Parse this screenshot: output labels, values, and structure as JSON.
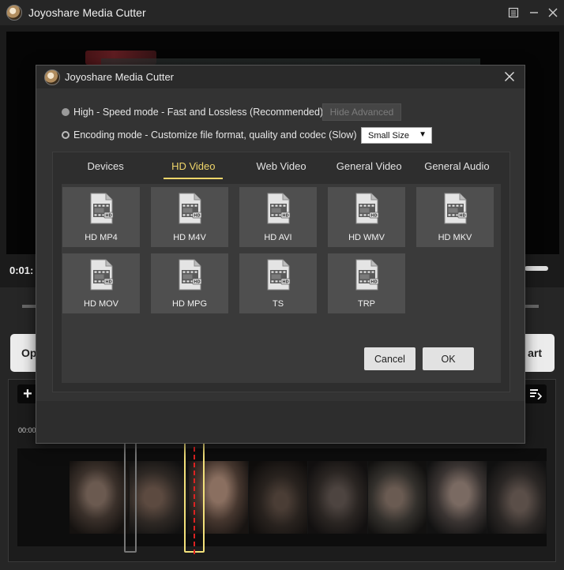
{
  "main_window": {
    "title": "Joyoshare Media Cutter",
    "time_display": "0:01:",
    "open_button_label": "Op",
    "start_button_label": "art",
    "timeline_start_time": "00:00",
    "add_button_label": "+",
    "win_controls": {
      "menu_icon": "menu-icon",
      "minimize_icon": "minimize-icon",
      "close_icon": "close-icon"
    }
  },
  "dialog": {
    "title": "Joyoshare Media Cutter",
    "close_icon": "close-icon",
    "modes": [
      {
        "label": "High - Speed mode - Fast and Lossless (Recommended)",
        "selected": false
      },
      {
        "label": "Encoding mode - Customize file format, quality and codec (Slow)",
        "selected": true
      }
    ],
    "hide_advanced_label": "Hide Advanced",
    "quality_select": {
      "value": "Small Size"
    },
    "tabs": [
      {
        "label": "Devices",
        "active": false
      },
      {
        "label": "HD Video",
        "active": true
      },
      {
        "label": "Web Video",
        "active": false
      },
      {
        "label": "General Video",
        "active": false
      },
      {
        "label": "General Audio",
        "active": false
      }
    ],
    "formats": [
      {
        "label": "HD MP4"
      },
      {
        "label": "HD M4V"
      },
      {
        "label": "HD AVI"
      },
      {
        "label": "HD WMV"
      },
      {
        "label": "HD MKV"
      },
      {
        "label": "HD MOV"
      },
      {
        "label": "HD MPG"
      },
      {
        "label": "TS"
      },
      {
        "label": "TRP"
      }
    ],
    "cancel_label": "Cancel",
    "ok_label": "OK"
  },
  "colors": {
    "accent_tab": "#f0d66a",
    "dialog_bg": "#333333",
    "tile_bg": "#4f4f4f",
    "playhead": "#dd2222",
    "selection": "#f2e07a"
  }
}
